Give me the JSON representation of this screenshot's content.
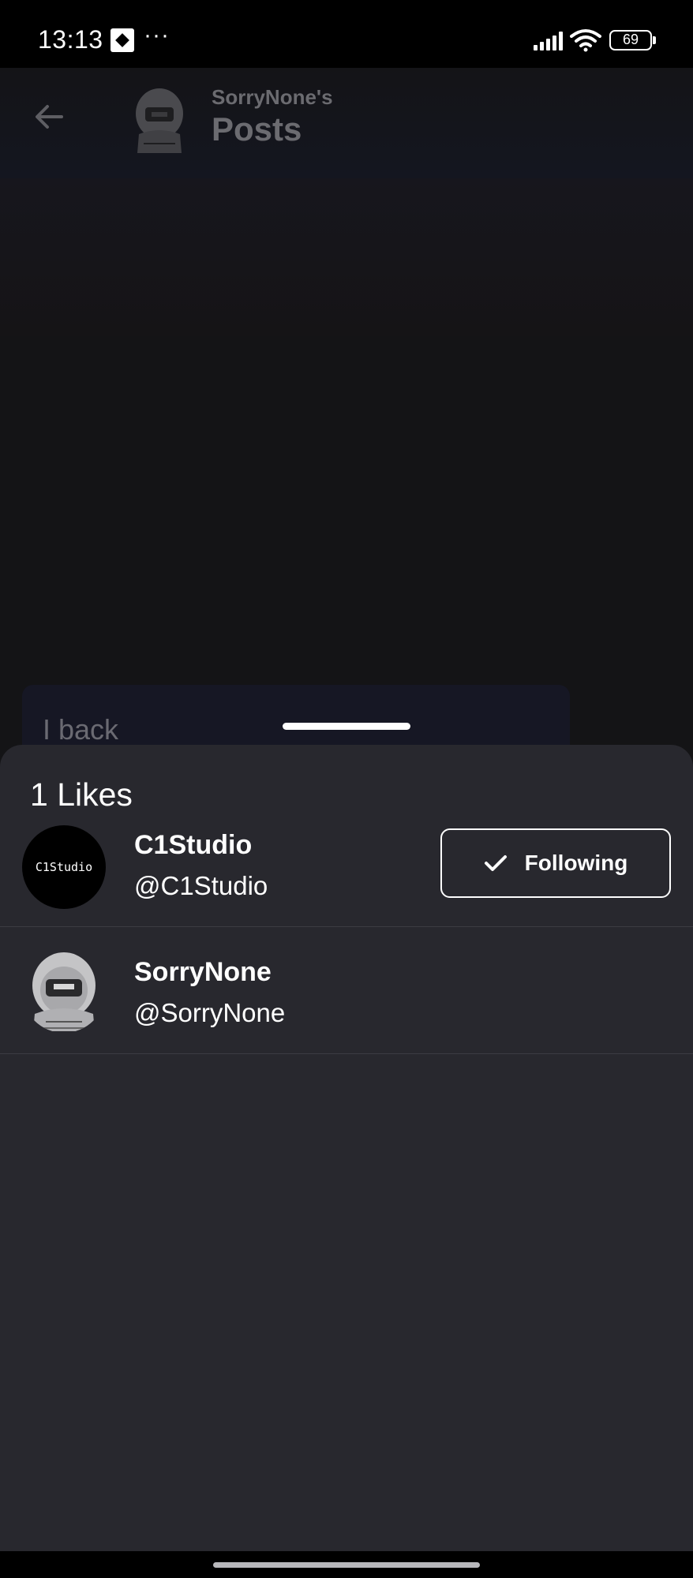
{
  "status_bar": {
    "time": "13:13",
    "dots": "···",
    "battery": "69",
    "icons": [
      "app-notification-icon",
      "signal-icon",
      "wifi-icon",
      "battery-icon"
    ]
  },
  "background_page": {
    "header_subtitle": "SorryNone's",
    "header_title": "Posts",
    "card_text": "I back"
  },
  "likes_sheet": {
    "title": "1 Likes",
    "users": [
      {
        "name": "C1Studio",
        "handle": "@C1Studio",
        "avatar_text": "C1Studio",
        "follow_label": "Following"
      },
      {
        "name": "SorryNone",
        "handle": "@SorryNone"
      }
    ]
  },
  "colors": {
    "sheet_bg": "#28282e",
    "page_bg": "#141416",
    "divider": "#3c3c43"
  }
}
